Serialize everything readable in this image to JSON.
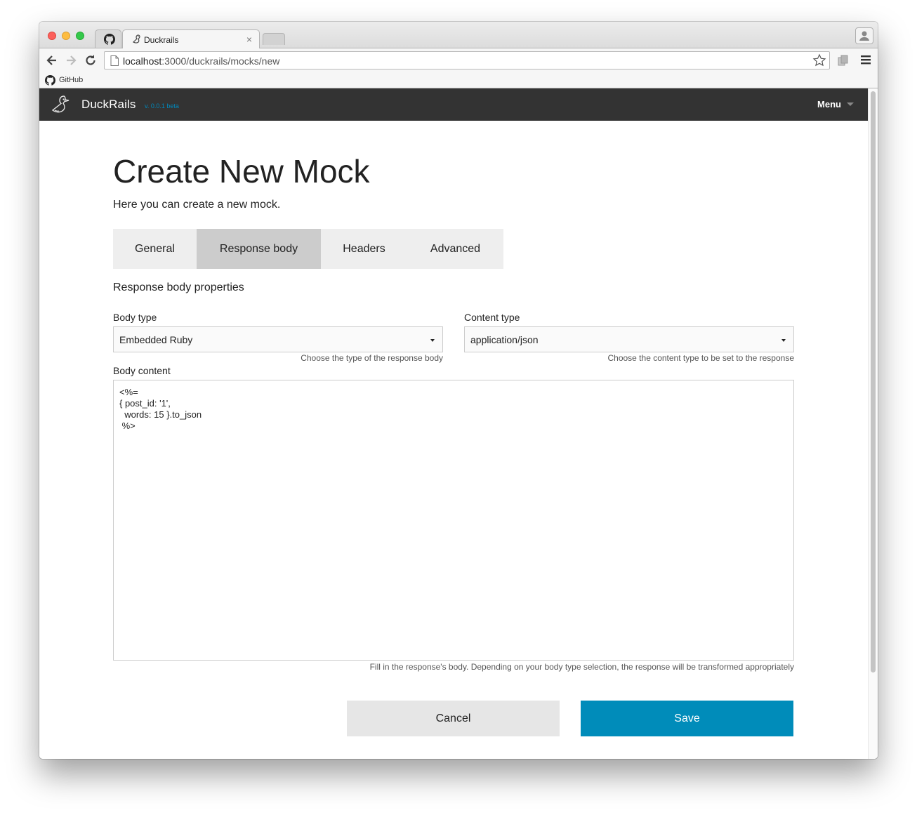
{
  "browser": {
    "active_tab_title": "Duckrails",
    "tab_close_glyph": "×",
    "url_host": "localhost",
    "url_rest": ":3000/duckrails/mocks/new",
    "bookmark_label": "GitHub"
  },
  "navbar": {
    "brand": "DuckRails",
    "version": "v. 0.0.1 beta",
    "menu_label": "Menu"
  },
  "page": {
    "title": "Create New Mock",
    "subtitle": "Here you can create a new mock."
  },
  "tabs": [
    {
      "label": "General",
      "active": false
    },
    {
      "label": "Response body",
      "active": true
    },
    {
      "label": "Headers",
      "active": false
    },
    {
      "label": "Advanced",
      "active": false
    }
  ],
  "form": {
    "section_title": "Response body properties",
    "body_type": {
      "label": "Body type",
      "value": "Embedded Ruby",
      "help": "Choose the type of the response body"
    },
    "content_type": {
      "label": "Content type",
      "value": "application/json",
      "help": "Choose the content type to be set to the response"
    },
    "body_content": {
      "label": "Body content",
      "value": "<%=\n{ post_id: '1',\n  words: 15 }.to_json\n %>",
      "help": "Fill in the response's body. Depending on your body type selection, the response will be transformed appropriately"
    }
  },
  "actions": {
    "cancel": "Cancel",
    "save": "Save"
  },
  "colors": {
    "navbar_bg": "#333333",
    "accent": "#008cba",
    "active_tab_bg": "#cccccc",
    "tabs_bg": "#eeeeee"
  },
  "icons": [
    "github-icon",
    "duck-icon",
    "back-icon",
    "forward-icon",
    "reload-icon",
    "page-icon",
    "star-icon",
    "extension-icon",
    "hamburger-icon",
    "profile-icon"
  ]
}
